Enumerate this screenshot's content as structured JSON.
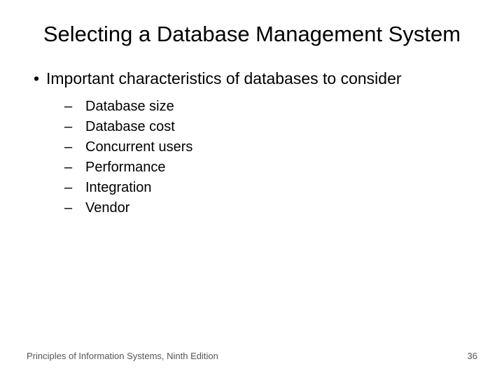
{
  "slide": {
    "title": "Selecting a Database Management System",
    "main_bullet": "Important characteristics of databases to consider",
    "sub_bullets": [
      "Database size",
      "Database cost",
      "Concurrent users",
      "Performance",
      "Integration",
      "Vendor"
    ]
  },
  "footer": {
    "left": "Principles of Information Systems, Ninth Edition",
    "right": "36"
  }
}
